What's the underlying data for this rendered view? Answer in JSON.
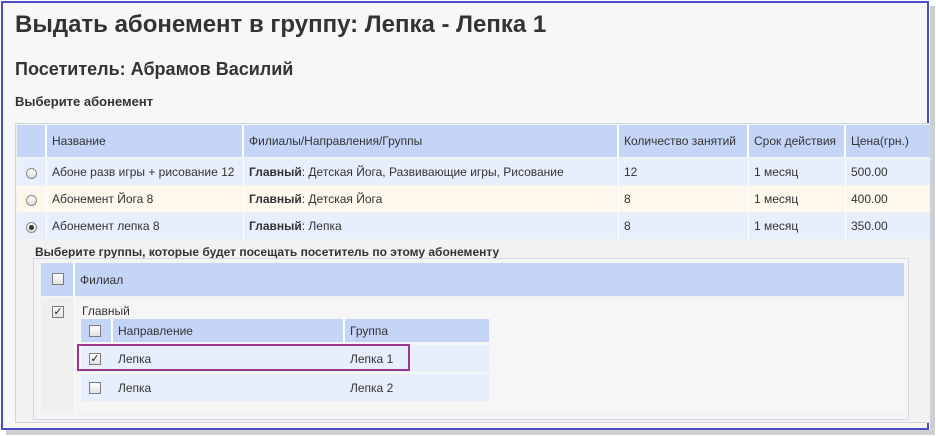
{
  "page": {
    "title": "Выдать абонемент в группу: Лепка - Лепка 1",
    "visitor": "Посетитель: Абрамов Василий",
    "choose_label": "Выберите абонемент"
  },
  "subscriptions_table": {
    "headers": {
      "name": "Название",
      "branches": "Филиалы/Направления/Группы",
      "count": "Количество занятий",
      "period": "Срок действия",
      "price": "Цена(грн.)"
    },
    "rows": [
      {
        "name": "Абоне разв игры + рисование 12",
        "branch": "Главный",
        "groups": ": Детская Йога, Развивающие игры, Рисование",
        "count": "12",
        "period": "1 месяц",
        "price": "500.00",
        "selected": false
      },
      {
        "name": "Абонемент Йога 8",
        "branch": "Главный",
        "groups": ": Детская Йога",
        "count": "8",
        "period": "1 месяц",
        "price": "400.00",
        "selected": false
      },
      {
        "name": "Абонемент лепка 8",
        "branch": "Главный",
        "groups": ": Лепка",
        "count": "8",
        "period": "1 месяц",
        "price": "350.00",
        "selected": true
      }
    ]
  },
  "groups_panel": {
    "title": "Выберите группы, которые будет посещать посетитель по этому абонементу",
    "branch_header": "Филиал",
    "branch_name": "Главный",
    "branch_checked": true,
    "headers": {
      "direction": "Направление",
      "group": "Группа"
    },
    "rows": [
      {
        "direction": "Лепка",
        "group": "Лепка 1",
        "checked": true
      },
      {
        "direction": "Лепка",
        "group": "Лепка 2",
        "checked": false
      }
    ],
    "check_mark": "✓"
  },
  "colors": {
    "header_bg": "#c5d5f8",
    "row_blue": "#e8effc",
    "row_cream": "#fdf7ec",
    "frame": "#4a4fc4",
    "highlight": "#9b3a8c"
  }
}
